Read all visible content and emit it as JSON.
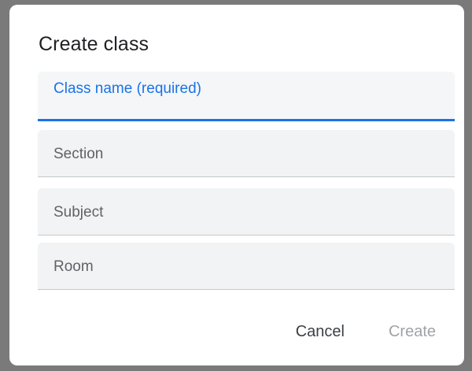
{
  "dialog": {
    "title": "Create class",
    "fields": [
      {
        "label": "Class name (required)",
        "value": "",
        "focused": true
      },
      {
        "label": "Section",
        "value": ""
      },
      {
        "label": "Subject",
        "value": ""
      },
      {
        "label": "Room",
        "value": ""
      }
    ],
    "actions": {
      "cancel_label": "Cancel",
      "create_label": "Create",
      "create_enabled": false
    }
  },
  "colors": {
    "accent": "#1a73e8",
    "field_background": "#f1f3f4",
    "disabled_text": "#a0a3a6",
    "backdrop": "#7a7a7a"
  }
}
